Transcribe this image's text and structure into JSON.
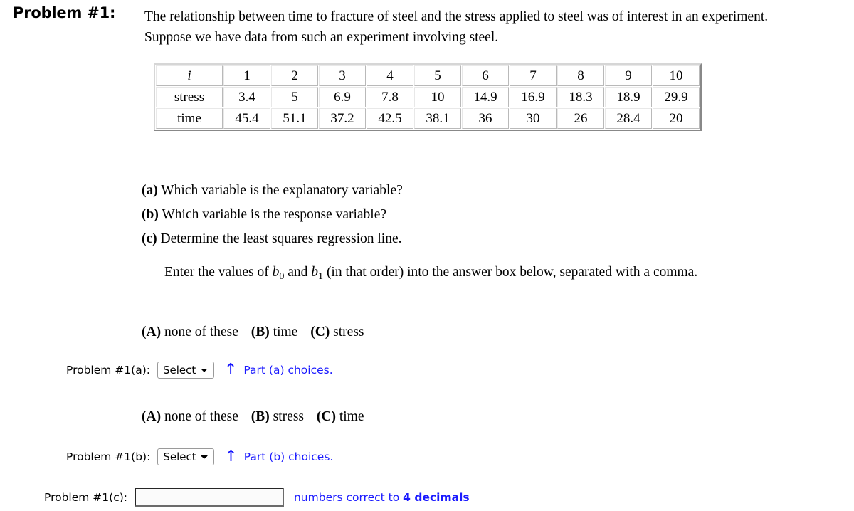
{
  "problem": {
    "header": "Problem #1:",
    "statement_line1": "The relationship between time to fracture of steel and the stress applied to steel was of interest in an experiment.",
    "statement_line2": "Suppose we have data from such an experiment involving steel."
  },
  "data_table": {
    "row_labels": [
      "i",
      "stress",
      "time"
    ],
    "index": [
      "1",
      "2",
      "3",
      "4",
      "5",
      "6",
      "7",
      "8",
      "9",
      "10"
    ],
    "stress": [
      "3.4",
      "5",
      "6.9",
      "7.8",
      "10",
      "14.9",
      "16.9",
      "18.3",
      "18.9",
      "29.9"
    ],
    "time": [
      "45.4",
      "51.1",
      "37.2",
      "42.5",
      "38.1",
      "36",
      "30",
      "26",
      "28.4",
      "20"
    ]
  },
  "subquestions": [
    {
      "label": "(a)",
      "text": "Which variable is the explanatory variable?"
    },
    {
      "label": "(b)",
      "text": "Which variable is the response variable?"
    },
    {
      "label": "(c)",
      "text": "Determine the least squares regression line."
    }
  ],
  "instruction": {
    "prefix": "Enter the values of ",
    "var1": "b",
    "var1_sub": "0",
    "middle": " and ",
    "var2": "b",
    "var2_sub": "1",
    "suffix": " (in that order) into the answer box below, separated with a comma."
  },
  "choices_a": [
    {
      "letter": "(A)",
      "text": "none of these"
    },
    {
      "letter": "(B)",
      "text": "time"
    },
    {
      "letter": "(C)",
      "text": "stress"
    }
  ],
  "choices_b": [
    {
      "letter": "(A)",
      "text": "none of these"
    },
    {
      "letter": "(B)",
      "text": "stress"
    },
    {
      "letter": "(C)",
      "text": "time"
    }
  ],
  "answers": {
    "part_a": {
      "label": "Problem #1(a):",
      "select_value": "Select",
      "select_options": [
        "Select",
        "(A)",
        "(B)",
        "(C)"
      ],
      "arrow_icon": "up-arrow-icon",
      "hint": "Part (a) choices."
    },
    "part_b": {
      "label": "Problem #1(b):",
      "select_value": "Select",
      "select_options": [
        "Select",
        "(A)",
        "(B)",
        "(C)"
      ],
      "arrow_icon": "up-arrow-icon",
      "hint": "Part (b) choices."
    },
    "part_c": {
      "label": "Problem #1(c):",
      "input_value": "",
      "input_placeholder": "",
      "hint_prefix": "numbers correct to ",
      "hint_bold": "4 decimals"
    }
  },
  "colors": {
    "hint_blue": "#1a1aff",
    "arrow_blue": "#1414ff",
    "text_black": "#000000",
    "page_background": "#ffffff"
  }
}
